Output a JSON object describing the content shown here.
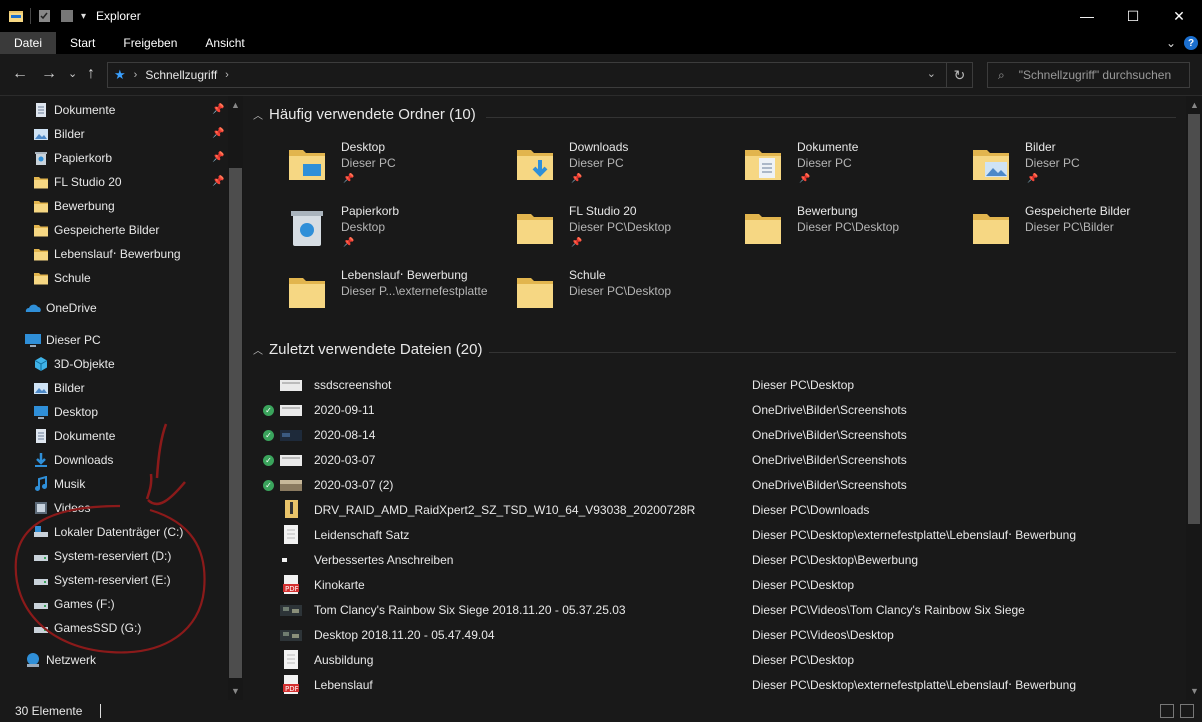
{
  "window": {
    "title": "Explorer",
    "minimize": "—",
    "maximize": "☐",
    "close": "✕"
  },
  "ribbon": {
    "tabs": [
      "Datei",
      "Start",
      "Freigeben",
      "Ansicht"
    ],
    "expand": "⌄",
    "help": "?"
  },
  "nav": {
    "back": "←",
    "forward": "→",
    "recent": "⌄",
    "up": "↑",
    "crumb": "Schnellzugriff",
    "search_placeholder": "\"Schnellzugriff\" durchsuchen"
  },
  "sidebar": {
    "quick_access": [
      {
        "label": "Dokumente",
        "icon": "documents-icon",
        "pinned": true
      },
      {
        "label": "Bilder",
        "icon": "pictures-icon",
        "pinned": true
      },
      {
        "label": "Papierkorb",
        "icon": "recycle-bin-icon",
        "pinned": true
      },
      {
        "label": "FL Studio 20",
        "icon": "folder-icon",
        "pinned": true
      },
      {
        "label": "Bewerbung",
        "icon": "folder-icon",
        "pinned": false
      },
      {
        "label": "Gespeicherte Bilder",
        "icon": "folder-icon",
        "pinned": false
      },
      {
        "label": "Lebenslauf‧ Bewerbung",
        "icon": "folder-icon",
        "pinned": false
      },
      {
        "label": "Schule",
        "icon": "folder-icon",
        "pinned": false
      }
    ],
    "onedrive": "OneDrive",
    "this_pc": "Dieser PC",
    "pc_items": [
      {
        "label": "3D-Objekte",
        "icon": "3d-objects-icon"
      },
      {
        "label": "Bilder",
        "icon": "pictures-icon"
      },
      {
        "label": "Desktop",
        "icon": "desktop-icon"
      },
      {
        "label": "Dokumente",
        "icon": "documents-icon"
      },
      {
        "label": "Downloads",
        "icon": "downloads-icon"
      },
      {
        "label": "Musik",
        "icon": "music-icon"
      },
      {
        "label": "Videos",
        "icon": "videos-icon"
      },
      {
        "label": "Lokaler Datenträger (C:)",
        "icon": "system-drive-icon"
      },
      {
        "label": "System-reserviert (D:)",
        "icon": "drive-icon"
      },
      {
        "label": "System-reserviert (E:)",
        "icon": "drive-icon"
      },
      {
        "label": "Games (F:)",
        "icon": "drive-icon"
      },
      {
        "label": "GamesSSD (G:)",
        "icon": "drive-icon"
      }
    ],
    "network": "Netzwerk"
  },
  "frequent": {
    "header": "Häufig verwendete Ordner (10)",
    "folders": [
      {
        "name": "Desktop",
        "loc": "Dieser PC",
        "pinned": true,
        "icon": "desktop-folder-icon"
      },
      {
        "name": "Downloads",
        "loc": "Dieser PC",
        "pinned": true,
        "icon": "downloads-folder-icon"
      },
      {
        "name": "Dokumente",
        "loc": "Dieser PC",
        "pinned": true,
        "icon": "documents-folder-icon"
      },
      {
        "name": "Bilder",
        "loc": "Dieser PC",
        "pinned": true,
        "icon": "pictures-folder-icon"
      },
      {
        "name": "Papierkorb",
        "loc": "Desktop",
        "pinned": true,
        "icon": "recycle-bin-icon"
      },
      {
        "name": "FL Studio 20",
        "loc": "Dieser PC\\Desktop",
        "pinned": true,
        "icon": "folder-icon"
      },
      {
        "name": "Bewerbung",
        "loc": "Dieser PC\\Desktop",
        "pinned": false,
        "icon": "folder-icon"
      },
      {
        "name": "Gespeicherte Bilder",
        "loc": "Dieser PC\\Bilder",
        "pinned": false,
        "icon": "folder-icon"
      },
      {
        "name": "Lebenslauf‧ Bewerbung",
        "loc": "Dieser P...\\externefestplatte",
        "pinned": false,
        "icon": "folder-icon"
      },
      {
        "name": "Schule",
        "loc": "Dieser PC\\Desktop",
        "pinned": false,
        "icon": "folder-icon"
      }
    ]
  },
  "recent": {
    "header": "Zuletzt verwendete Dateien (20)",
    "files": [
      {
        "name": "ssdscreenshot",
        "path": "Dieser PC\\Desktop",
        "synced": false,
        "thumb": "image"
      },
      {
        "name": "2020-09-11",
        "path": "OneDrive\\Bilder\\Screenshots",
        "synced": true,
        "thumb": "image"
      },
      {
        "name": "2020-08-14",
        "path": "OneDrive\\Bilder\\Screenshots",
        "synced": true,
        "thumb": "dark-image"
      },
      {
        "name": "2020-03-07",
        "path": "OneDrive\\Bilder\\Screenshots",
        "synced": true,
        "thumb": "image"
      },
      {
        "name": "2020-03-07 (2)",
        "path": "OneDrive\\Bilder\\Screenshots",
        "synced": true,
        "thumb": "photo"
      },
      {
        "name": "DRV_RAID_AMD_RaidXpert2_SZ_TSD_W10_64_V93038_20200728R",
        "path": "Dieser PC\\Downloads",
        "synced": false,
        "thumb": "zip"
      },
      {
        "name": "Leidenschaft Satz",
        "path": "Dieser PC\\Desktop\\externefestplatte\\Lebenslauf‧ Bewerbung",
        "synced": false,
        "thumb": "doc"
      },
      {
        "name": "Verbessertes Anschreiben",
        "path": "Dieser PC\\Desktop\\Bewerbung",
        "synced": false,
        "thumb": "dark-doc"
      },
      {
        "name": "Kinokarte",
        "path": "Dieser PC\\Desktop",
        "synced": false,
        "thumb": "pdf"
      },
      {
        "name": "Tom Clancy's Rainbow Six  Siege 2018.11.20 - 05.37.25.03",
        "path": "Dieser PC\\Videos\\Tom Clancy's Rainbow Six  Siege",
        "synced": false,
        "thumb": "video"
      },
      {
        "name": "Desktop 2018.11.20 - 05.47.49.04",
        "path": "Dieser PC\\Videos\\Desktop",
        "synced": false,
        "thumb": "video"
      },
      {
        "name": "Ausbildung",
        "path": "Dieser PC\\Desktop",
        "synced": false,
        "thumb": "doc"
      },
      {
        "name": "Lebenslauf",
        "path": "Dieser PC\\Desktop\\externefestplatte\\Lebenslauf‧ Bewerbung",
        "synced": false,
        "thumb": "pdf"
      }
    ]
  },
  "status": {
    "count": "30 Elemente"
  },
  "colors": {
    "background": "#191919",
    "titlebar": "#000000",
    "accent": "#1b6fcf",
    "annotation": "#8b1a1a",
    "sync_ok": "#3aa45c"
  }
}
